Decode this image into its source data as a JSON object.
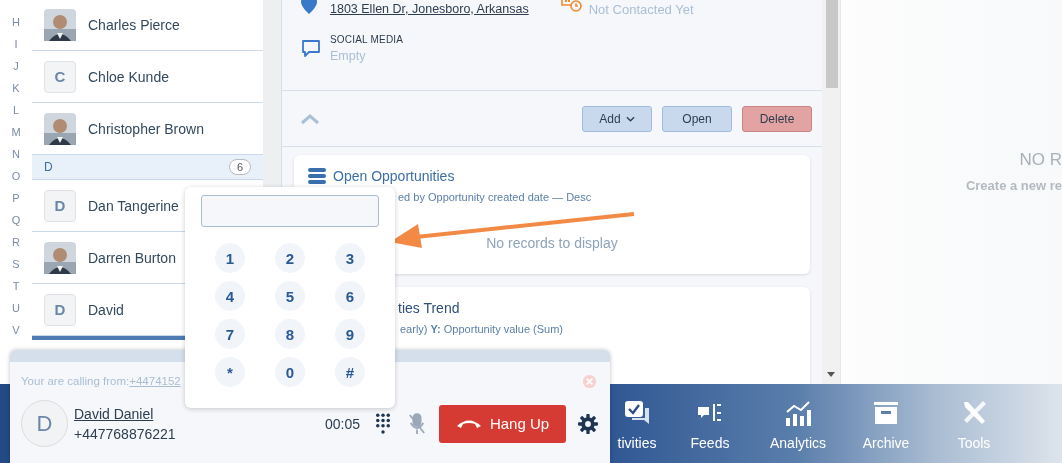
{
  "alphabet": [
    "H",
    "I",
    "J",
    "K",
    "L",
    "M",
    "N",
    "O",
    "P",
    "Q",
    "R",
    "S",
    "T",
    "U",
    "V"
  ],
  "contacts": [
    {
      "name": "Charles Pierce"
    },
    {
      "kind": "initial",
      "name": "Chloe Kunde",
      "initial": "C"
    },
    {
      "name": "Christopher Brown"
    },
    {
      "kind": "header",
      "letter": "D",
      "count": "6"
    },
    {
      "kind": "initial",
      "name": "Dan Tangerine",
      "initial": "D"
    },
    {
      "name": "Darren Burton"
    },
    {
      "kind": "initial",
      "name": "David",
      "initial": "D"
    }
  ],
  "contact_details": {
    "address": "1803 Ellen Dr, Jonesboro, Arkansas",
    "status": "Not Contacted Yet",
    "social_media": {
      "label": "SOCIAL MEDIA",
      "value": "Empty"
    }
  },
  "toolbar": {
    "buttons": [
      {
        "label": "Add",
        "kind": "dropdown"
      },
      {
        "label": "Open",
        "kind": "primary"
      },
      {
        "label": "Delete",
        "kind": "danger"
      }
    ]
  },
  "cards": [
    {
      "title": "Open Opportunities",
      "subtitle": "ed by Opportunity created date — Desc",
      "message": "No records to display"
    },
    {
      "title": "ties Trend",
      "subtitle": "early) **Y:** Opportunity value (Sum)"
    }
  ],
  "side_panel": {
    "title": "NO R",
    "hint": "Create a new re"
  },
  "nav": [
    {
      "label": "tivities"
    },
    {
      "label": "Feeds"
    },
    {
      "label": "Analytics"
    },
    {
      "label": "Archive"
    },
    {
      "label": "Tools"
    }
  ],
  "call": {
    "calling_from_label": "Your are calling from:",
    "calling_from_number": "+4474152",
    "avatar_initial": "D",
    "contact_name": "David Daniel",
    "phone": "+447768876221",
    "timer": "00:05",
    "muted": true,
    "hang_up": "Hang Up"
  },
  "dialpad": {
    "keys": [
      "1",
      "2",
      "3",
      "4",
      "5",
      "6",
      "7",
      "8",
      "9",
      "*",
      "0",
      "#"
    ]
  }
}
